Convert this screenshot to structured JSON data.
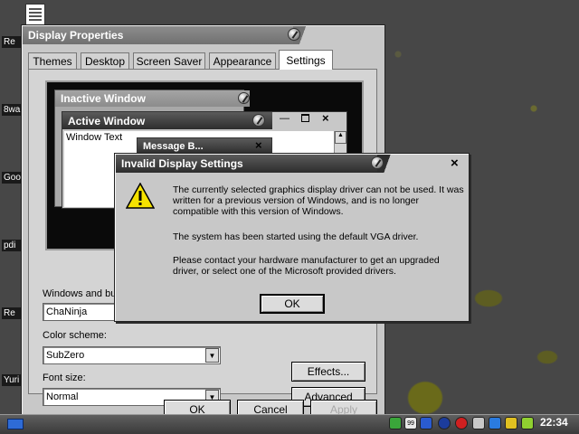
{
  "desktop": {
    "labels": [
      "Re",
      "8wa",
      "Goo",
      "pdi",
      "Re",
      "Yuri"
    ]
  },
  "display_properties": {
    "title": "Display Properties",
    "tabs": [
      "Themes",
      "Desktop",
      "Screen Saver",
      "Appearance",
      "Settings"
    ],
    "active_tab": "Settings",
    "preview": {
      "inactive_title": "Inactive Window",
      "active_title": "Active Window",
      "window_text": "Window Text",
      "message_title": "Message B..."
    },
    "windows_buttons_label": "Windows and bu",
    "windows_buttons_value": "ChaNinja",
    "color_scheme_label": "Color scheme:",
    "color_scheme_value": "SubZero",
    "font_size_label": "Font size:",
    "font_size_value": "Normal",
    "effects_label": "Effects...",
    "advanced_label": "Advanced",
    "ok_label": "OK",
    "cancel_label": "Cancel",
    "apply_label": "Apply"
  },
  "dialog": {
    "title": "Invalid Display Settings",
    "close_glyph": "×",
    "message_1": "The currently selected graphics display driver can not be used.  It was written for a previous version of Windows, and is no longer compatible with this version of Windows.",
    "message_2": "The system has been started using the default VGA driver.",
    "message_3": "Please contact your hardware manufacturer to get an upgraded driver, or select one of the Microsoft provided drivers.",
    "ok_label": "OK"
  },
  "taskbar": {
    "clock": "22:34",
    "tray_badge": "99"
  },
  "colors": {
    "desktop": "#474747",
    "window_face": "#c8c8c8",
    "title_dark": "#2d2d2d",
    "warning_yellow": "#f5e200"
  }
}
